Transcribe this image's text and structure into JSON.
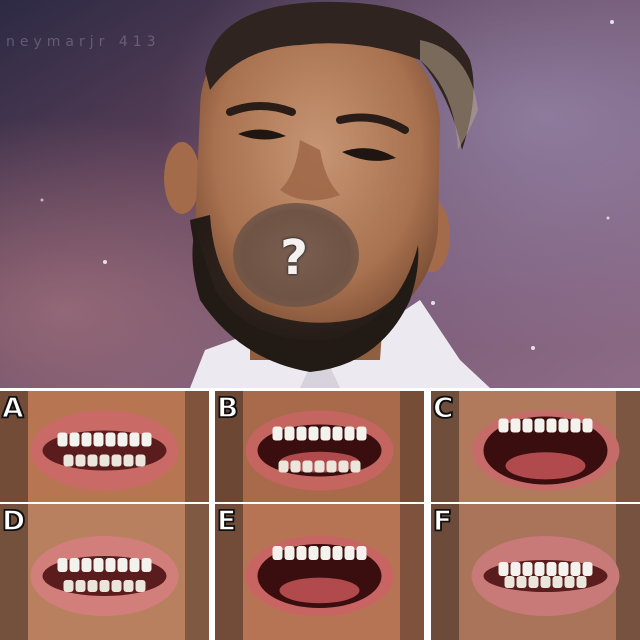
{
  "watermark": "neymarjr 413",
  "center_mark": "?",
  "options": [
    {
      "letter": "A",
      "variant": "smile-broad",
      "skin": "#b87552",
      "lip": "#c96a66"
    },
    {
      "letter": "B",
      "variant": "open-teeth",
      "skin": "#a86a4a",
      "lip": "#c46560"
    },
    {
      "letter": "C",
      "variant": "wide-open",
      "skin": "#b27a5c",
      "lip": "#c56b68"
    },
    {
      "letter": "D",
      "variant": "smile-lower",
      "skin": "#b8805e",
      "lip": "#d27f7c"
    },
    {
      "letter": "E",
      "variant": "laugh-open",
      "skin": "#b67454",
      "lip": "#c86462"
    },
    {
      "letter": "F",
      "variant": "grin-soft",
      "skin": "#a9745a",
      "lip": "#c87a78"
    }
  ]
}
